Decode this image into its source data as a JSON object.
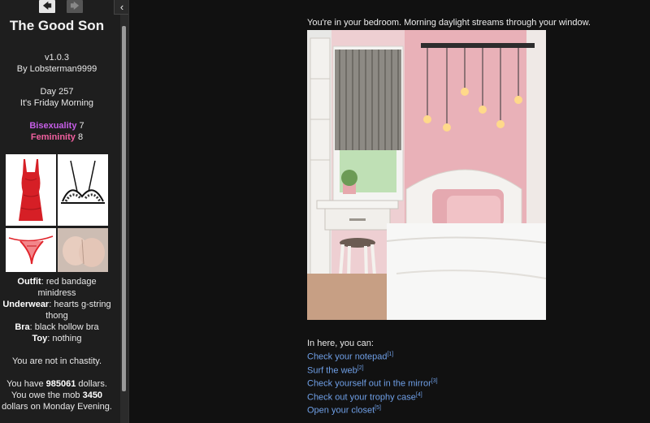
{
  "sidebar": {
    "nav": {
      "back_icon": "🡄",
      "forward_icon": "🡆",
      "collapse_icon": "‹"
    },
    "title": "The Good Son",
    "version": "v1.0.3",
    "author": "By Lobsterman9999",
    "day": "Day 257",
    "time": "It's Friday Morning",
    "stats": [
      {
        "name": "Bisexuality",
        "value": "7",
        "color": "#c55ee6"
      },
      {
        "name": "Femininity",
        "value": "8",
        "color": "#f0609f"
      }
    ],
    "outfit_images": [
      "red-dress-image",
      "black-bra-image",
      "red-thong-image",
      "pose-image"
    ],
    "outfit": {
      "outfit_label": "Outfit",
      "outfit_value": ": red bandage minidress",
      "underwear_label": "Underwear",
      "underwear_value": ": hearts g-string thong",
      "bra_label": "Bra",
      "bra_value": ": black hollow bra",
      "toy_label": "Toy",
      "toy_value": ": nothing"
    },
    "chastity": "You are not in chastity.",
    "money": {
      "have_pre": "You have ",
      "have_amount": "985061",
      "have_post": " dollars.",
      "owe_pre": "You owe the mob ",
      "owe_amount": "3450",
      "owe_post": "dollars on Monday Evening."
    }
  },
  "main": {
    "intro": "You're in your bedroom. Morning daylight streams through your window.",
    "can_label": "In here, you can:",
    "actions": [
      {
        "label": "Check your notepad",
        "key": "[1]"
      },
      {
        "label": "Surf the web",
        "key": "[2]"
      },
      {
        "label": "Check yourself out in the mirror",
        "key": "[3]"
      },
      {
        "label": "Check out your trophy case",
        "key": "[4]"
      },
      {
        "label": "Open your closet",
        "key": "[5]"
      }
    ]
  }
}
